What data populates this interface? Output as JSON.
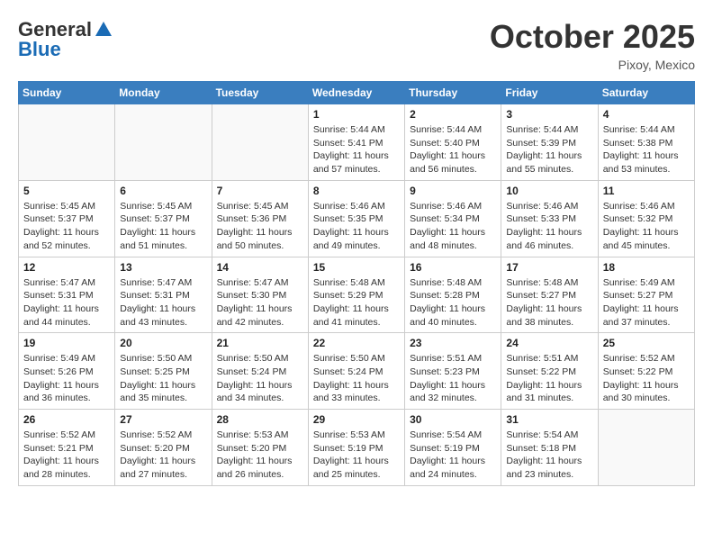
{
  "header": {
    "logo_general": "General",
    "logo_blue": "Blue",
    "month_title": "October 2025",
    "location": "Pixoy, Mexico"
  },
  "weekdays": [
    "Sunday",
    "Monday",
    "Tuesday",
    "Wednesday",
    "Thursday",
    "Friday",
    "Saturday"
  ],
  "weeks": [
    [
      {
        "day": "",
        "sunrise": "",
        "sunset": "",
        "daylight": ""
      },
      {
        "day": "",
        "sunrise": "",
        "sunset": "",
        "daylight": ""
      },
      {
        "day": "",
        "sunrise": "",
        "sunset": "",
        "daylight": ""
      },
      {
        "day": "1",
        "sunrise": "Sunrise: 5:44 AM",
        "sunset": "Sunset: 5:41 PM",
        "daylight": "Daylight: 11 hours and 57 minutes."
      },
      {
        "day": "2",
        "sunrise": "Sunrise: 5:44 AM",
        "sunset": "Sunset: 5:40 PM",
        "daylight": "Daylight: 11 hours and 56 minutes."
      },
      {
        "day": "3",
        "sunrise": "Sunrise: 5:44 AM",
        "sunset": "Sunset: 5:39 PM",
        "daylight": "Daylight: 11 hours and 55 minutes."
      },
      {
        "day": "4",
        "sunrise": "Sunrise: 5:44 AM",
        "sunset": "Sunset: 5:38 PM",
        "daylight": "Daylight: 11 hours and 53 minutes."
      }
    ],
    [
      {
        "day": "5",
        "sunrise": "Sunrise: 5:45 AM",
        "sunset": "Sunset: 5:37 PM",
        "daylight": "Daylight: 11 hours and 52 minutes."
      },
      {
        "day": "6",
        "sunrise": "Sunrise: 5:45 AM",
        "sunset": "Sunset: 5:37 PM",
        "daylight": "Daylight: 11 hours and 51 minutes."
      },
      {
        "day": "7",
        "sunrise": "Sunrise: 5:45 AM",
        "sunset": "Sunset: 5:36 PM",
        "daylight": "Daylight: 11 hours and 50 minutes."
      },
      {
        "day": "8",
        "sunrise": "Sunrise: 5:46 AM",
        "sunset": "Sunset: 5:35 PM",
        "daylight": "Daylight: 11 hours and 49 minutes."
      },
      {
        "day": "9",
        "sunrise": "Sunrise: 5:46 AM",
        "sunset": "Sunset: 5:34 PM",
        "daylight": "Daylight: 11 hours and 48 minutes."
      },
      {
        "day": "10",
        "sunrise": "Sunrise: 5:46 AM",
        "sunset": "Sunset: 5:33 PM",
        "daylight": "Daylight: 11 hours and 46 minutes."
      },
      {
        "day": "11",
        "sunrise": "Sunrise: 5:46 AM",
        "sunset": "Sunset: 5:32 PM",
        "daylight": "Daylight: 11 hours and 45 minutes."
      }
    ],
    [
      {
        "day": "12",
        "sunrise": "Sunrise: 5:47 AM",
        "sunset": "Sunset: 5:31 PM",
        "daylight": "Daylight: 11 hours and 44 minutes."
      },
      {
        "day": "13",
        "sunrise": "Sunrise: 5:47 AM",
        "sunset": "Sunset: 5:31 PM",
        "daylight": "Daylight: 11 hours and 43 minutes."
      },
      {
        "day": "14",
        "sunrise": "Sunrise: 5:47 AM",
        "sunset": "Sunset: 5:30 PM",
        "daylight": "Daylight: 11 hours and 42 minutes."
      },
      {
        "day": "15",
        "sunrise": "Sunrise: 5:48 AM",
        "sunset": "Sunset: 5:29 PM",
        "daylight": "Daylight: 11 hours and 41 minutes."
      },
      {
        "day": "16",
        "sunrise": "Sunrise: 5:48 AM",
        "sunset": "Sunset: 5:28 PM",
        "daylight": "Daylight: 11 hours and 40 minutes."
      },
      {
        "day": "17",
        "sunrise": "Sunrise: 5:48 AM",
        "sunset": "Sunset: 5:27 PM",
        "daylight": "Daylight: 11 hours and 38 minutes."
      },
      {
        "day": "18",
        "sunrise": "Sunrise: 5:49 AM",
        "sunset": "Sunset: 5:27 PM",
        "daylight": "Daylight: 11 hours and 37 minutes."
      }
    ],
    [
      {
        "day": "19",
        "sunrise": "Sunrise: 5:49 AM",
        "sunset": "Sunset: 5:26 PM",
        "daylight": "Daylight: 11 hours and 36 minutes."
      },
      {
        "day": "20",
        "sunrise": "Sunrise: 5:50 AM",
        "sunset": "Sunset: 5:25 PM",
        "daylight": "Daylight: 11 hours and 35 minutes."
      },
      {
        "day": "21",
        "sunrise": "Sunrise: 5:50 AM",
        "sunset": "Sunset: 5:24 PM",
        "daylight": "Daylight: 11 hours and 34 minutes."
      },
      {
        "day": "22",
        "sunrise": "Sunrise: 5:50 AM",
        "sunset": "Sunset: 5:24 PM",
        "daylight": "Daylight: 11 hours and 33 minutes."
      },
      {
        "day": "23",
        "sunrise": "Sunrise: 5:51 AM",
        "sunset": "Sunset: 5:23 PM",
        "daylight": "Daylight: 11 hours and 32 minutes."
      },
      {
        "day": "24",
        "sunrise": "Sunrise: 5:51 AM",
        "sunset": "Sunset: 5:22 PM",
        "daylight": "Daylight: 11 hours and 31 minutes."
      },
      {
        "day": "25",
        "sunrise": "Sunrise: 5:52 AM",
        "sunset": "Sunset: 5:22 PM",
        "daylight": "Daylight: 11 hours and 30 minutes."
      }
    ],
    [
      {
        "day": "26",
        "sunrise": "Sunrise: 5:52 AM",
        "sunset": "Sunset: 5:21 PM",
        "daylight": "Daylight: 11 hours and 28 minutes."
      },
      {
        "day": "27",
        "sunrise": "Sunrise: 5:52 AM",
        "sunset": "Sunset: 5:20 PM",
        "daylight": "Daylight: 11 hours and 27 minutes."
      },
      {
        "day": "28",
        "sunrise": "Sunrise: 5:53 AM",
        "sunset": "Sunset: 5:20 PM",
        "daylight": "Daylight: 11 hours and 26 minutes."
      },
      {
        "day": "29",
        "sunrise": "Sunrise: 5:53 AM",
        "sunset": "Sunset: 5:19 PM",
        "daylight": "Daylight: 11 hours and 25 minutes."
      },
      {
        "day": "30",
        "sunrise": "Sunrise: 5:54 AM",
        "sunset": "Sunset: 5:19 PM",
        "daylight": "Daylight: 11 hours and 24 minutes."
      },
      {
        "day": "31",
        "sunrise": "Sunrise: 5:54 AM",
        "sunset": "Sunset: 5:18 PM",
        "daylight": "Daylight: 11 hours and 23 minutes."
      },
      {
        "day": "",
        "sunrise": "",
        "sunset": "",
        "daylight": ""
      }
    ]
  ]
}
